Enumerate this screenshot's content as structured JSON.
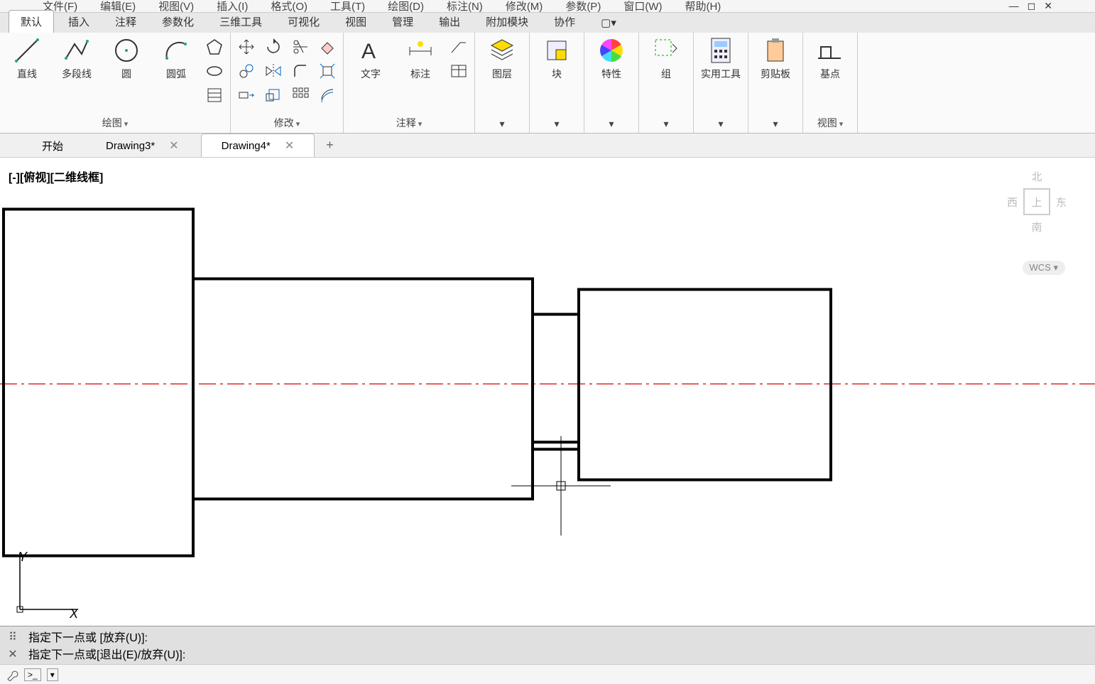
{
  "menubar": {
    "items": [
      "文件(F)",
      "编辑(E)",
      "视图(V)",
      "插入(I)",
      "格式(O)",
      "工具(T)",
      "绘图(D)",
      "标注(N)",
      "修改(M)",
      "参数(P)",
      "窗口(W)",
      "帮助(H)"
    ]
  },
  "ribbon_tabs": {
    "active": "默认",
    "items": [
      "默认",
      "插入",
      "注释",
      "参数化",
      "三维工具",
      "可视化",
      "视图",
      "管理",
      "输出",
      "附加模块",
      "协作"
    ]
  },
  "ribbon_panels": {
    "draw": {
      "label": "绘图",
      "tools_big": [
        {
          "name": "line",
          "label": "直线"
        },
        {
          "name": "polyline",
          "label": "多段线"
        },
        {
          "name": "circle",
          "label": "圆"
        },
        {
          "name": "arc",
          "label": "圆弧"
        }
      ]
    },
    "modify": {
      "label": "修改"
    },
    "annotate": {
      "label": "注释",
      "tools_big": [
        {
          "name": "text",
          "label": "文字"
        },
        {
          "name": "dim",
          "label": "标注"
        }
      ]
    },
    "layer": {
      "label": "图层"
    },
    "block": {
      "label": "块"
    },
    "property": {
      "label": "特性"
    },
    "group": {
      "label": "组"
    },
    "util": {
      "label": "实用工具"
    },
    "clipboard": {
      "label": "剪贴板"
    },
    "base": {
      "label": "基点",
      "panel": "视图"
    }
  },
  "filetabs": {
    "active_index": 2,
    "items": [
      {
        "label": "开始",
        "closable": false
      },
      {
        "label": "Drawing3*",
        "closable": true
      },
      {
        "label": "Drawing4*",
        "closable": true
      }
    ]
  },
  "viewport": {
    "label": "[-][俯视][二维线框]",
    "nav": {
      "n": "北",
      "w": "西",
      "e": "东",
      "s": "南",
      "face": "上"
    },
    "wcs": "WCS ▾"
  },
  "ucs": {
    "x": "X",
    "y": "Y"
  },
  "commandlog": {
    "line1": "指定下一点或 [放弃(U)]:",
    "line2": "指定下一点或[退出(E)/放弃(U)]:"
  },
  "cmdinput": {
    "prompt": ">_",
    "dropdown": "▾"
  }
}
